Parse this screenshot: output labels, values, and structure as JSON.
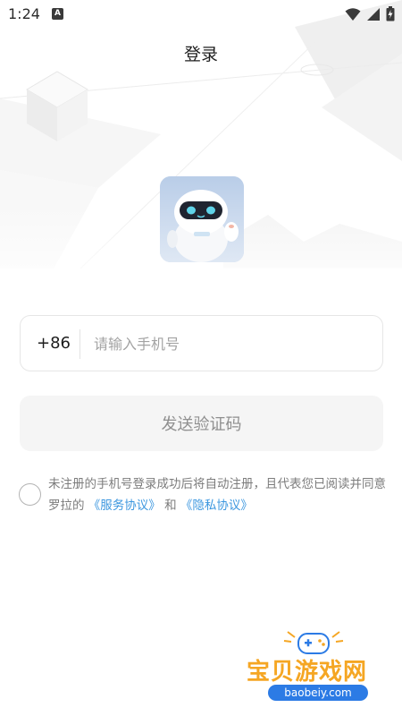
{
  "status_bar": {
    "time": "1:24",
    "notification_letter": "A"
  },
  "header": {
    "title": "登录"
  },
  "login_form": {
    "country_code": "+86",
    "phone_placeholder": "请输入手机号",
    "send_code_label": "发送验证码"
  },
  "agreement": {
    "text_before": "未注册的手机号登录成功后将自动注册，且代表您已阅读并同意罗拉的",
    "service_link": "《服务协议》",
    "connector": "和",
    "privacy_link": "《隐私协议》",
    "checked": false
  },
  "watermark": {
    "title": "宝贝游戏网",
    "url": "baobeiy.com"
  },
  "colors": {
    "link": "#3c97df",
    "button_bg": "#f5f5f5",
    "watermark_orange": "#f5a623",
    "watermark_blue": "#2c7be5"
  },
  "icons": [
    "wifi-icon",
    "signal-icon",
    "battery-icon",
    "gamepad-icon",
    "checkbox-circle-icon"
  ]
}
